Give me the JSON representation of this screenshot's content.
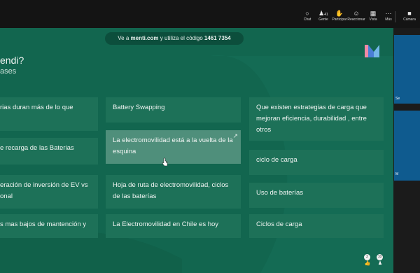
{
  "toolbar": {
    "chat": "Chat",
    "people": "Gente",
    "people_count": "41",
    "raise": "Participar",
    "react": "Reaccionar",
    "views": "Vista",
    "more": "Más",
    "camera": "Cámara"
  },
  "slide": {
    "join_prefix": "Ve a",
    "join_site": "menti.com",
    "join_mid": "y utiliza el código",
    "join_code": "1461 7354",
    "question_partial": "endi?",
    "sub_partial": "ases",
    "cards": [
      "rias duran más de lo que",
      "Battery Swapping",
      "Que existen estrategias de carga que mejoran eficiencia, durabilidad , entre otros",
      "e recarga de las Baterias",
      "La electromovilidad está a la vuelta de la esquina",
      "ciclo de carga",
      "eración de inversión de EV vs onal",
      "Hoja de ruta de electromovilidad, ciclos de las baterías",
      "Uso de baterías",
      "s mas bajos de mantención y",
      "La Electromovilidad en Chile es hoy",
      "Ciclos de carga"
    ],
    "count_a": "2",
    "count_b": "10"
  },
  "side": {
    "label_a": "Se",
    "label_b": "M"
  },
  "colors": {
    "slide_bg": "#12664f",
    "card_bg": "#1d7158",
    "highlight_card": "#4f8f7b",
    "pill_bg": "#0c4e3c"
  }
}
